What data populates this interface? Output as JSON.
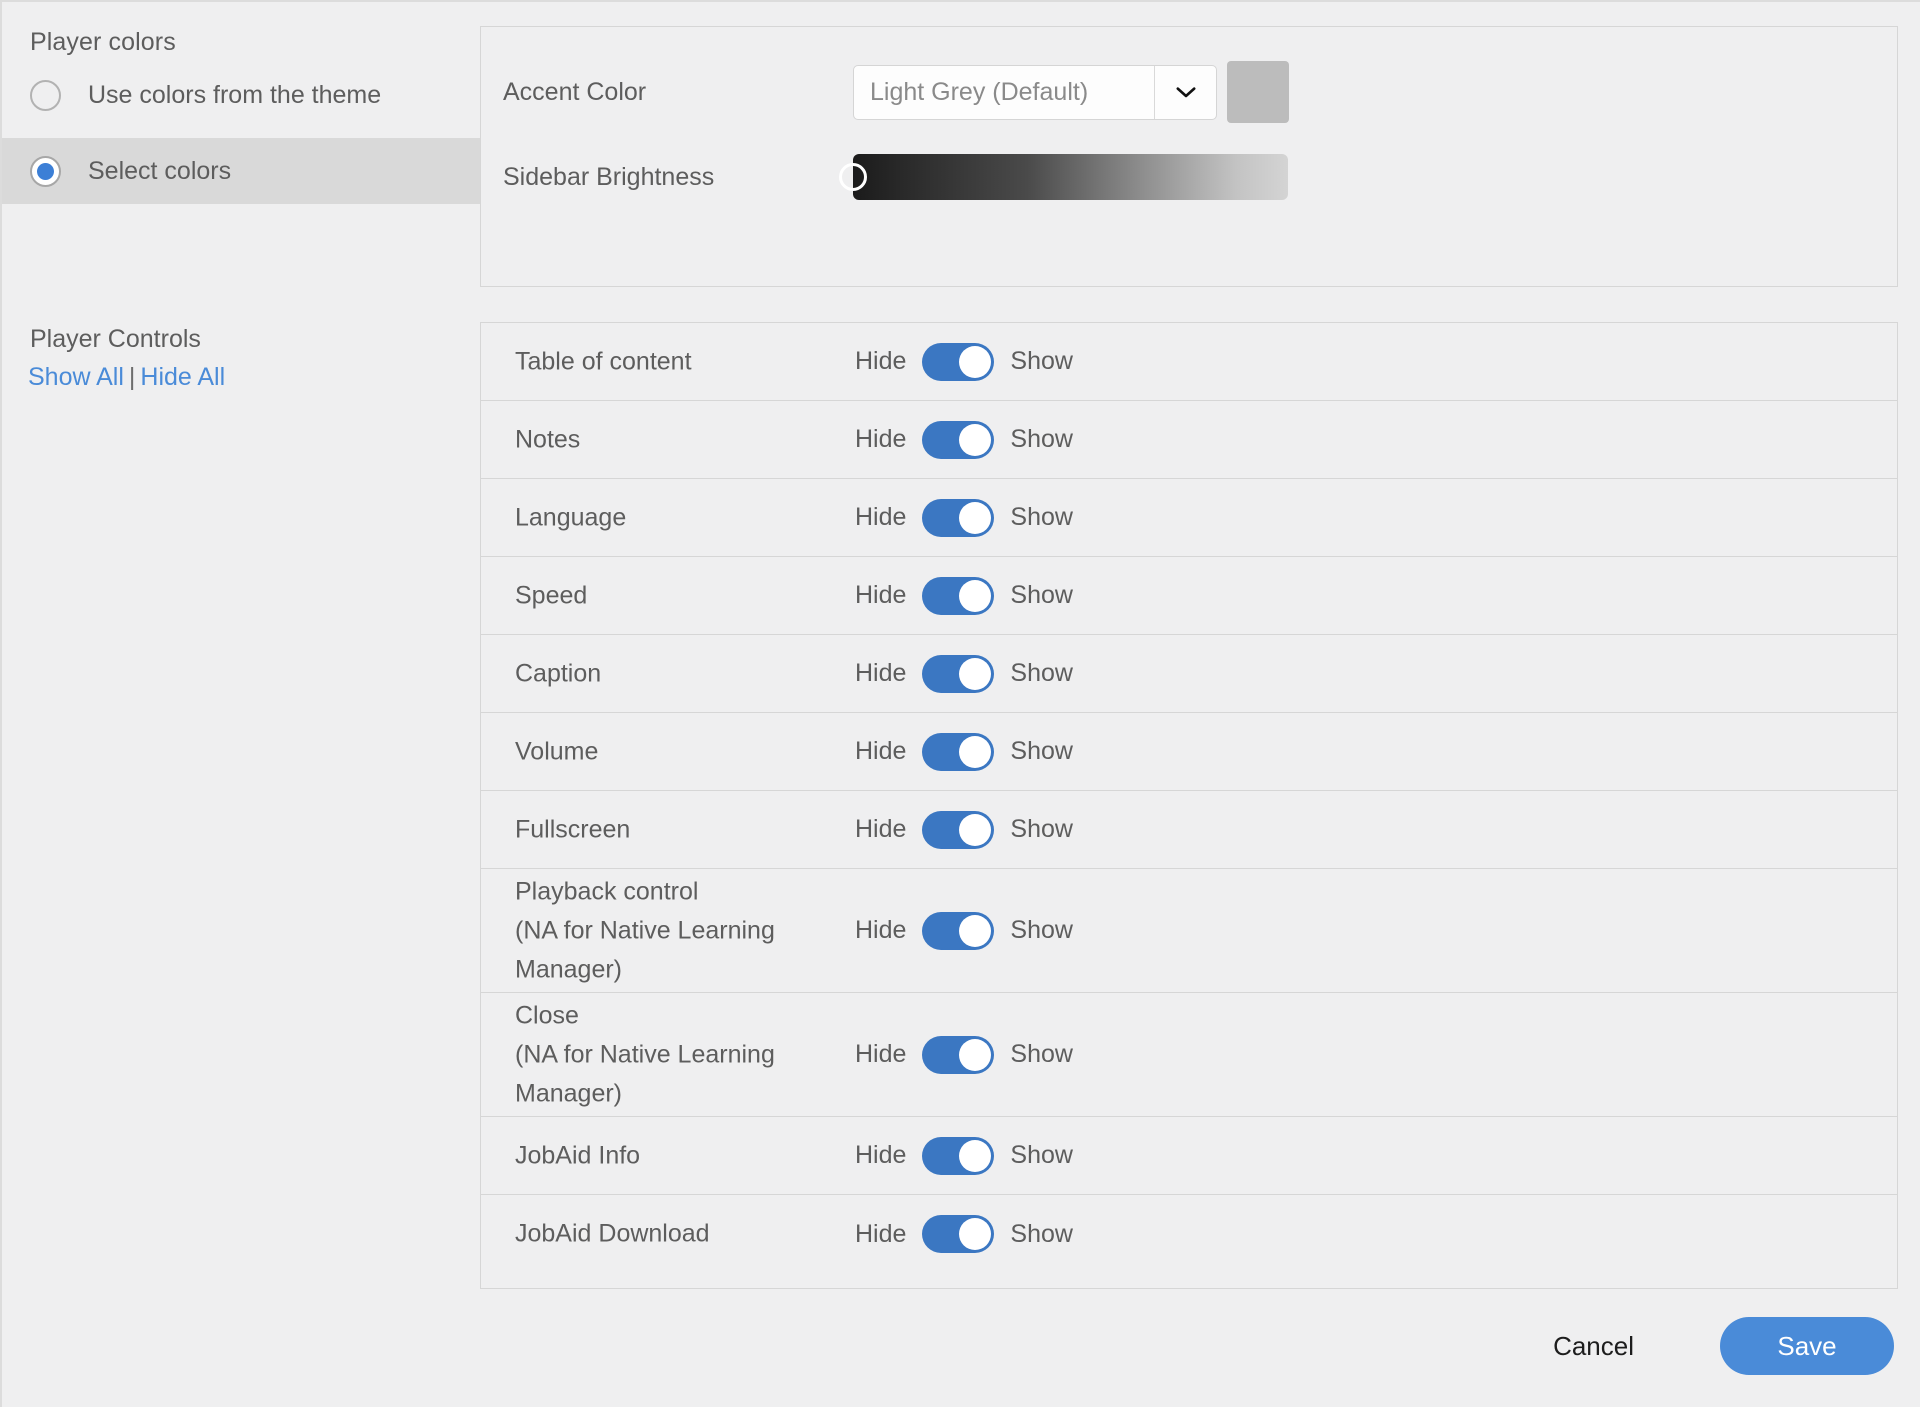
{
  "player_colors": {
    "title": "Player colors",
    "options": [
      {
        "label": "Use colors from the theme",
        "selected": false
      },
      {
        "label": "Select colors",
        "selected": true
      }
    ]
  },
  "color_panel": {
    "accent": {
      "label": "Accent Color",
      "value": "Light Grey (Default)",
      "swatch_color": "#bcbcbc",
      "arrow_icon": "chevron-down-icon"
    },
    "brightness": {
      "label": "Sidebar Brightness",
      "value_percent": 0,
      "gradient_from": "#1b1b1b",
      "gradient_to": "#d4d4d4"
    }
  },
  "player_controls": {
    "title": "Player Controls",
    "show_all_label": "Show All",
    "separator": "|",
    "hide_all_label": "Hide All",
    "link_color": "#4a8bd8",
    "toggle_hide_label": "Hide",
    "toggle_show_label": "Show",
    "toggle_on_color": "#3b77c2",
    "rows": [
      {
        "label": "Table of content",
        "state": "Show",
        "lines": 1
      },
      {
        "label": "Notes",
        "state": "Show",
        "lines": 1
      },
      {
        "label": "Language",
        "state": "Show",
        "lines": 1
      },
      {
        "label": "Speed",
        "state": "Show",
        "lines": 1
      },
      {
        "label": "Caption",
        "state": "Show",
        "lines": 1
      },
      {
        "label": "Volume",
        "state": "Show",
        "lines": 1
      },
      {
        "label": "Fullscreen",
        "state": "Show",
        "lines": 1
      },
      {
        "label": "Playback control\n(NA for Native Learning\nManager)",
        "state": "Show",
        "lines": 3
      },
      {
        "label": "Close\n(NA for Native Learning\nManager)",
        "state": "Show",
        "lines": 3
      },
      {
        "label": "JobAid Info",
        "state": "Show",
        "lines": 1
      },
      {
        "label": "JobAid Download",
        "state": "Show",
        "lines": 1
      }
    ]
  },
  "footer": {
    "cancel_label": "Cancel",
    "save_label": "Save",
    "save_color": "#4a8bd8"
  }
}
